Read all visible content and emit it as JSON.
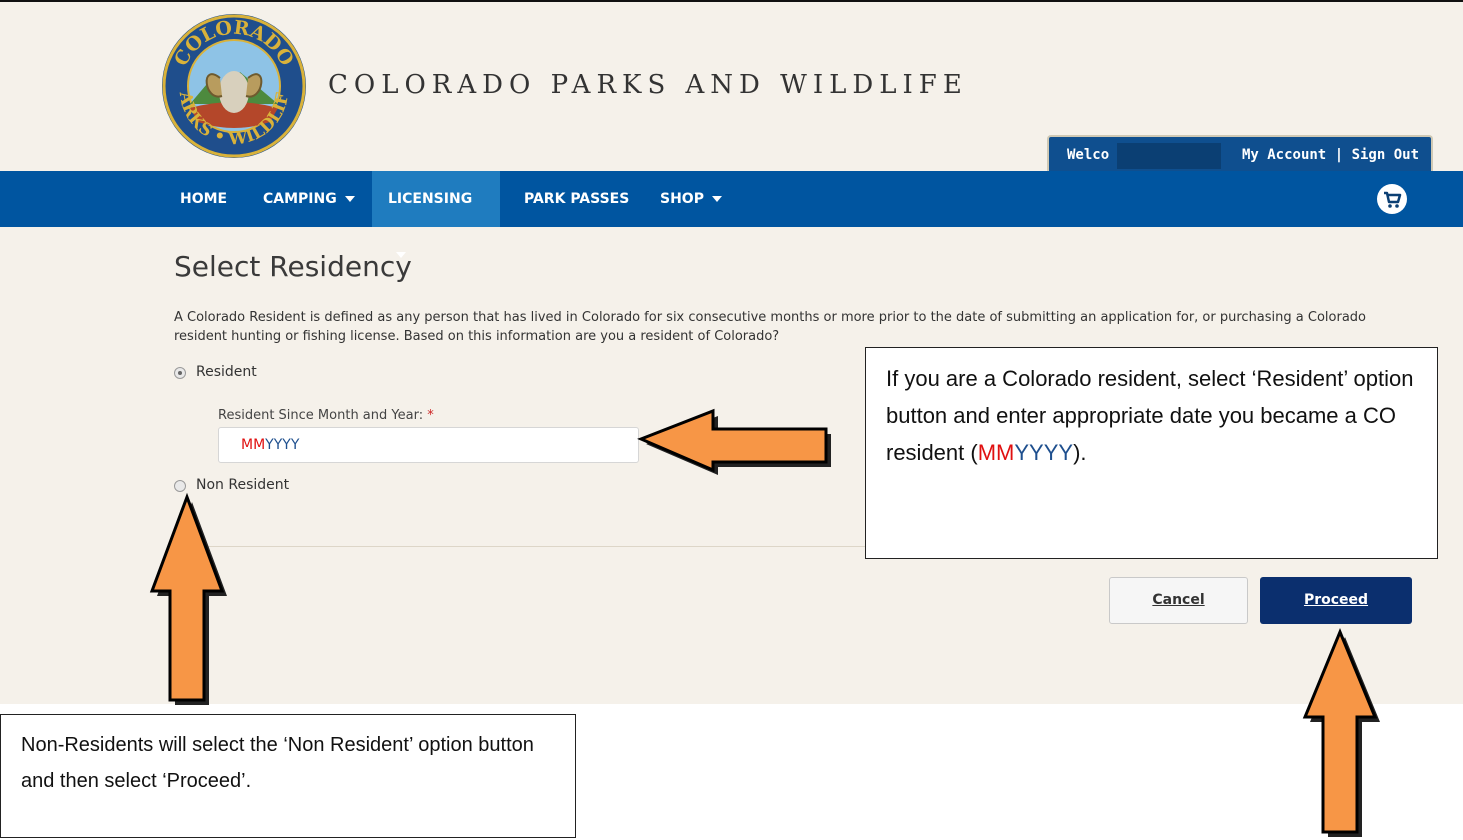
{
  "header": {
    "title": "COLORADO PARKS AND WILDLIFE",
    "logo": {
      "top_text": "COLORADO",
      "bottom_text": "PARKS • WILDLIFE",
      "icon": "bighorn-ram-seal"
    }
  },
  "account": {
    "welcome": "Welco",
    "my_account": "My Account",
    "separator": "|",
    "sign_out": "Sign Out"
  },
  "nav": {
    "items": [
      {
        "label": "HOME",
        "dropdown": false
      },
      {
        "label": "CAMPING",
        "dropdown": true
      },
      {
        "label": "LICENSING",
        "dropdown": true,
        "active": true
      },
      {
        "label": "PARK PASSES",
        "dropdown": false
      },
      {
        "label": "SHOP",
        "dropdown": true
      }
    ],
    "cart_icon": "cart-icon"
  },
  "main": {
    "title": "Select Residency",
    "intro": "A Colorado Resident is defined as any person that has lived in Colorado for six consecutive months or more prior to the date of submitting an application for, or purchasing a Colorado resident hunting or fishing license. Based on this information are you a resident of Colorado?",
    "resident_label": "Resident",
    "resident_since_label": "Resident Since Month and Year:",
    "required_marker": "*",
    "date_value_mm": "MM",
    "date_value_yyyy": "YYYY",
    "non_resident_label": "Non Resident",
    "selected": "Resident"
  },
  "buttons": {
    "cancel": "Cancel",
    "proceed": "Proceed"
  },
  "annotations": {
    "right_text_1": "If you are a Colorado resident, select ‘Resident’ option button and enter appropriate date you became a CO resident (",
    "right_mm": "MM",
    "right_yyyy": "YYYY",
    "right_text_2": ").",
    "left_text": "Non-Residents will select the ‘Non Resident’ option button and then select ‘Proceed’."
  },
  "colors": {
    "nav_blue": "#0055a0",
    "nav_active": "#1f7cbf",
    "proceed_navy": "#0b2f6e",
    "arrow_orange": "#f79646",
    "page_background": "#f5f1ea",
    "mm_red": "#e01010"
  }
}
